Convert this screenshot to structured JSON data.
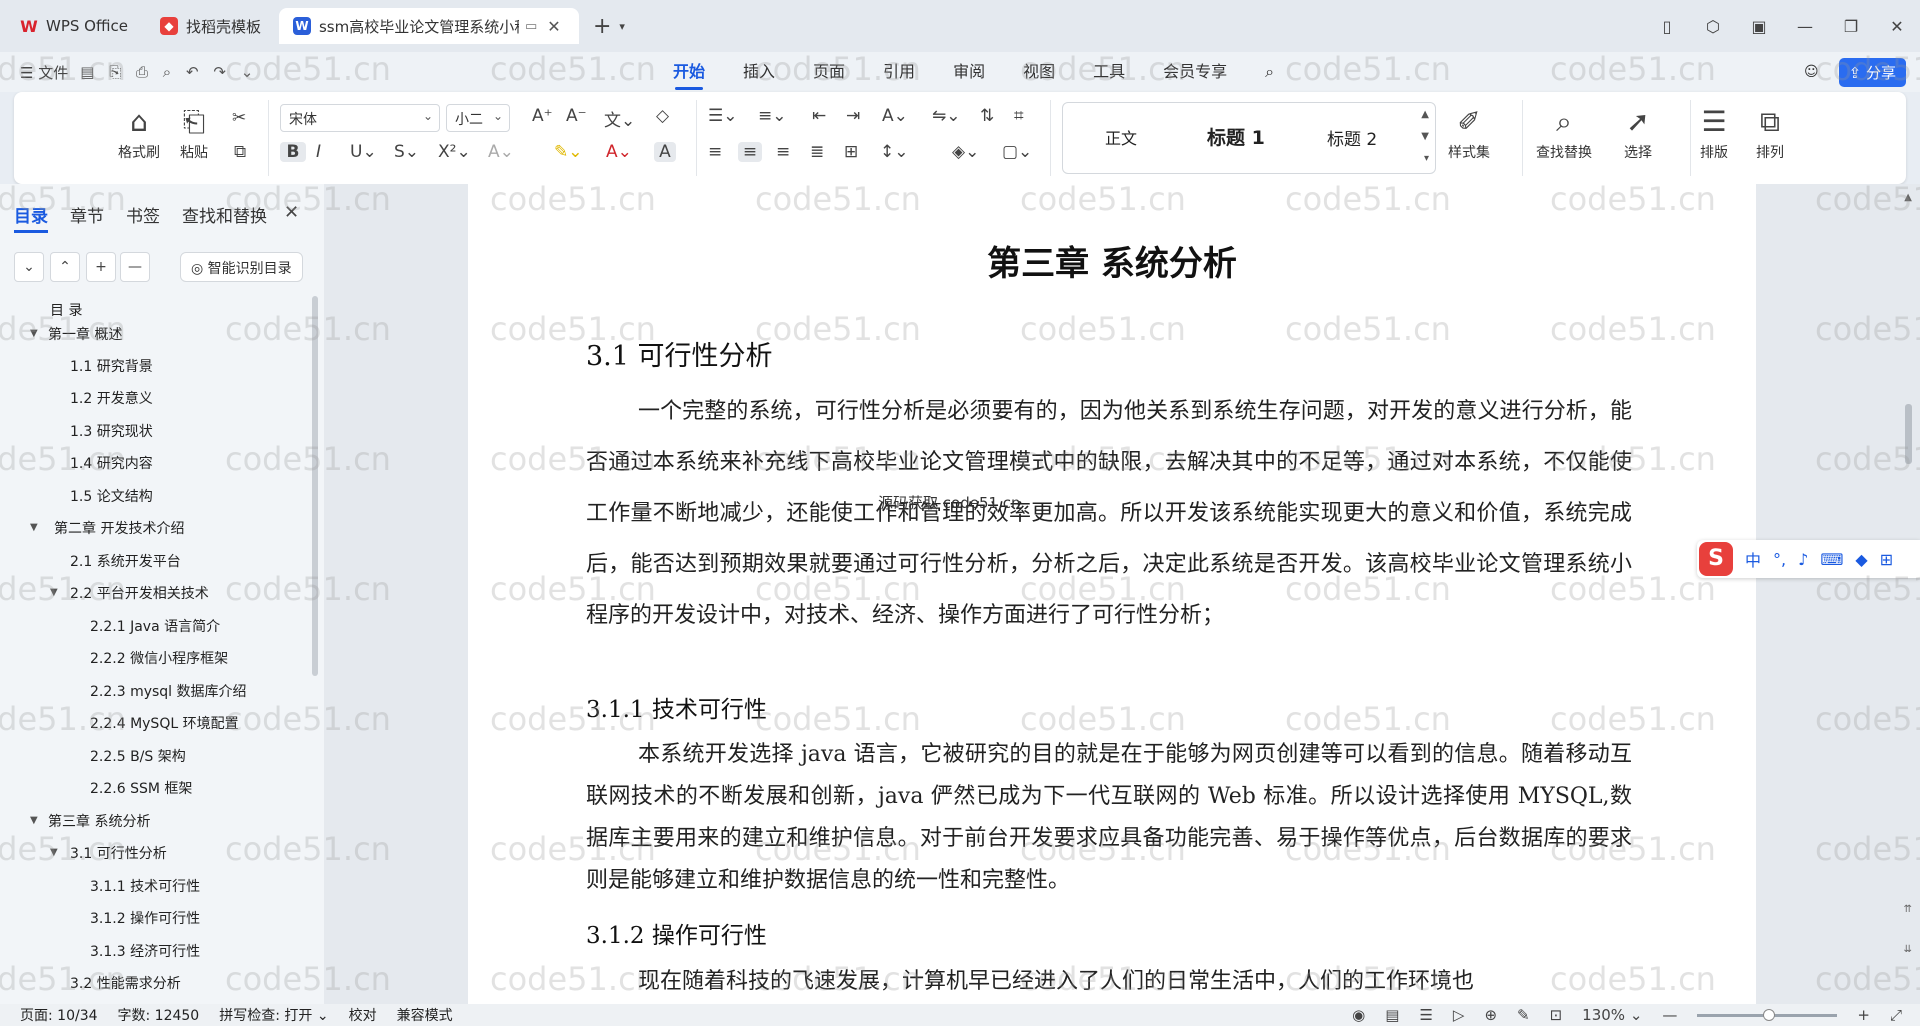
{
  "tabs": [
    {
      "label": "WPS Office",
      "icon": "wps-logo-icon"
    },
    {
      "label": "找稻壳模板",
      "icon": "docer-logo-icon"
    },
    {
      "label": "ssm高校毕业论文管理系统小程",
      "icon": "writer-doc-icon"
    }
  ],
  "menu": {
    "file_label": "文件",
    "items": [
      "开始",
      "插入",
      "页面",
      "引用",
      "审阅",
      "视图",
      "工具",
      "会员专享"
    ],
    "active": "开始",
    "share_label": "分享"
  },
  "ribbon": {
    "format_painter": "格式刷",
    "paste": "粘贴",
    "font_name": "宋体",
    "font_size": "小二",
    "styles": [
      "正文",
      "标题 1",
      "标题 2"
    ],
    "style_set": "样式集",
    "find_replace": "查找替换",
    "select": "选择",
    "layout": "排版",
    "arrange": "排列",
    "accent_color": "#1a5ae0"
  },
  "nav": {
    "tabs": [
      "目录",
      "章节",
      "书签",
      "查找和替换"
    ],
    "active_tab": "目录",
    "smart_toc_label": "智能识别目录",
    "toc": [
      {
        "label": "目  录"
      },
      {
        "label": "第一章  概述"
      },
      {
        "label": "1.1  研究背景"
      },
      {
        "label": "1.2  开发意义"
      },
      {
        "label": "1.3  研究现状"
      },
      {
        "label": "1.4  研究内容"
      },
      {
        "label": "1.5  论文结构"
      },
      {
        "label": "第二章  开发技术介绍"
      },
      {
        "label": "2.1  系统开发平台"
      },
      {
        "label": "2.2  平台开发相关技术"
      },
      {
        "label": "2.2.1    Java 语言简介"
      },
      {
        "label": "2.2.2    微信小程序框架"
      },
      {
        "label": "2.2.3    mysql 数据库介绍"
      },
      {
        "label": "2.2.4    MySQL 环境配置"
      },
      {
        "label": "2.2.5    B/S 架构"
      },
      {
        "label": "2.2.6    SSM 框架"
      },
      {
        "label": "第三章  系统分析"
      },
      {
        "label": "3.1  可行性分析"
      },
      {
        "label": "3.1.1 技术可行性"
      },
      {
        "label": "3.1.2 操作可行性"
      },
      {
        "label": "3.1.3  经济可行性"
      },
      {
        "label": "3.2 性能需求分析"
      }
    ]
  },
  "document": {
    "chapter_title": "第三章  系统分析",
    "section_title": "3.1  可行性分析",
    "para1": "一个完整的系统，可行性分析是必须要有的，因为他关系到系统生存问题，对开发的意义进行分析，能否通过本系统来补充线下高校毕业论文管理模式中的缺限，去解决其中的不足等，通过对本系统，不仅能使工作量不断地减少，还能使工作和管理的效率更加高。所以开发该系统能实现更大的意义和价值，系统完成后，能否达到预期效果就要通过可行性分析，分析之后，决定此系统是否开发。该高校毕业论文管理系统小程序的开发设计中，对技术、经济、操作方面进行了可行性分析；",
    "sub1_title": "3.1.1 技术可行性",
    "para2": "本系统开发选择 java 语言，它被研究的目的就是在于能够为网页创建等可以看到的信息。随着移动互联网技术的不断发展和创新，java 俨然已成为下一代互联网的 Web 标准。所以设计选择使用 MYSQL,数据库主要用来的建立和维护信息。对于前台开发要求应具备功能完善、易于操作等优点，后台数据库的要求则是能够建立和维护数据信息的统一性和完整性。",
    "sub2_title": "3.1.2 操作可行性",
    "para3": "现在随着科技的飞速发展，计算机早已经进入了人们的日常生活中，人们的工作环境也",
    "overlay_text": "源码获取  code51.cn"
  },
  "ime": {
    "label": "中"
  },
  "status": {
    "page": "页面: 10/34",
    "words": "字数: 12450",
    "spell": "拼写检查: 打开",
    "proof": "校对",
    "compat": "兼容模式",
    "zoom": "130%"
  },
  "watermark": "code51.cn"
}
